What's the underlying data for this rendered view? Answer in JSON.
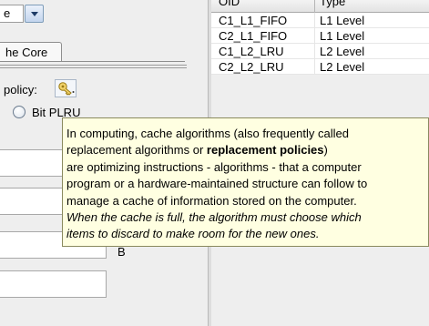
{
  "left": {
    "combo_text": "e",
    "tab_label": "he Core",
    "policy_label": "policy:",
    "radio_label": "Bit PLRU",
    "b_label": "B"
  },
  "table": {
    "headers": [
      "OID",
      "Type"
    ],
    "rows": [
      {
        "oid": "C1_L1_FIFO",
        "type": "L1 Level"
      },
      {
        "oid": "C2_L1_FIFO",
        "type": "L1 Level"
      },
      {
        "oid": "C1_L2_LRU",
        "type": "L2 Level"
      },
      {
        "oid": "C2_L2_LRU",
        "type": "L2 Level"
      }
    ]
  },
  "tooltip": {
    "line1": "In computing, cache algorithms (also frequently called",
    "line2_pre": "replacement algorithms or ",
    "line2_bold": "replacement policies",
    "line2_post": ")",
    "line3": "are optimizing instructions - algorithms - that a computer",
    "line4": "program or a hardware-maintained structure can follow to",
    "line5": "manage a cache of information stored on the computer.",
    "line6": "When the cache is full, the algorithm must choose which",
    "line7": "items to discard to make room for the new ones."
  },
  "colors": {
    "tooltip_bg": "#ffffe1",
    "combo_arrow": "#1d3b66"
  }
}
